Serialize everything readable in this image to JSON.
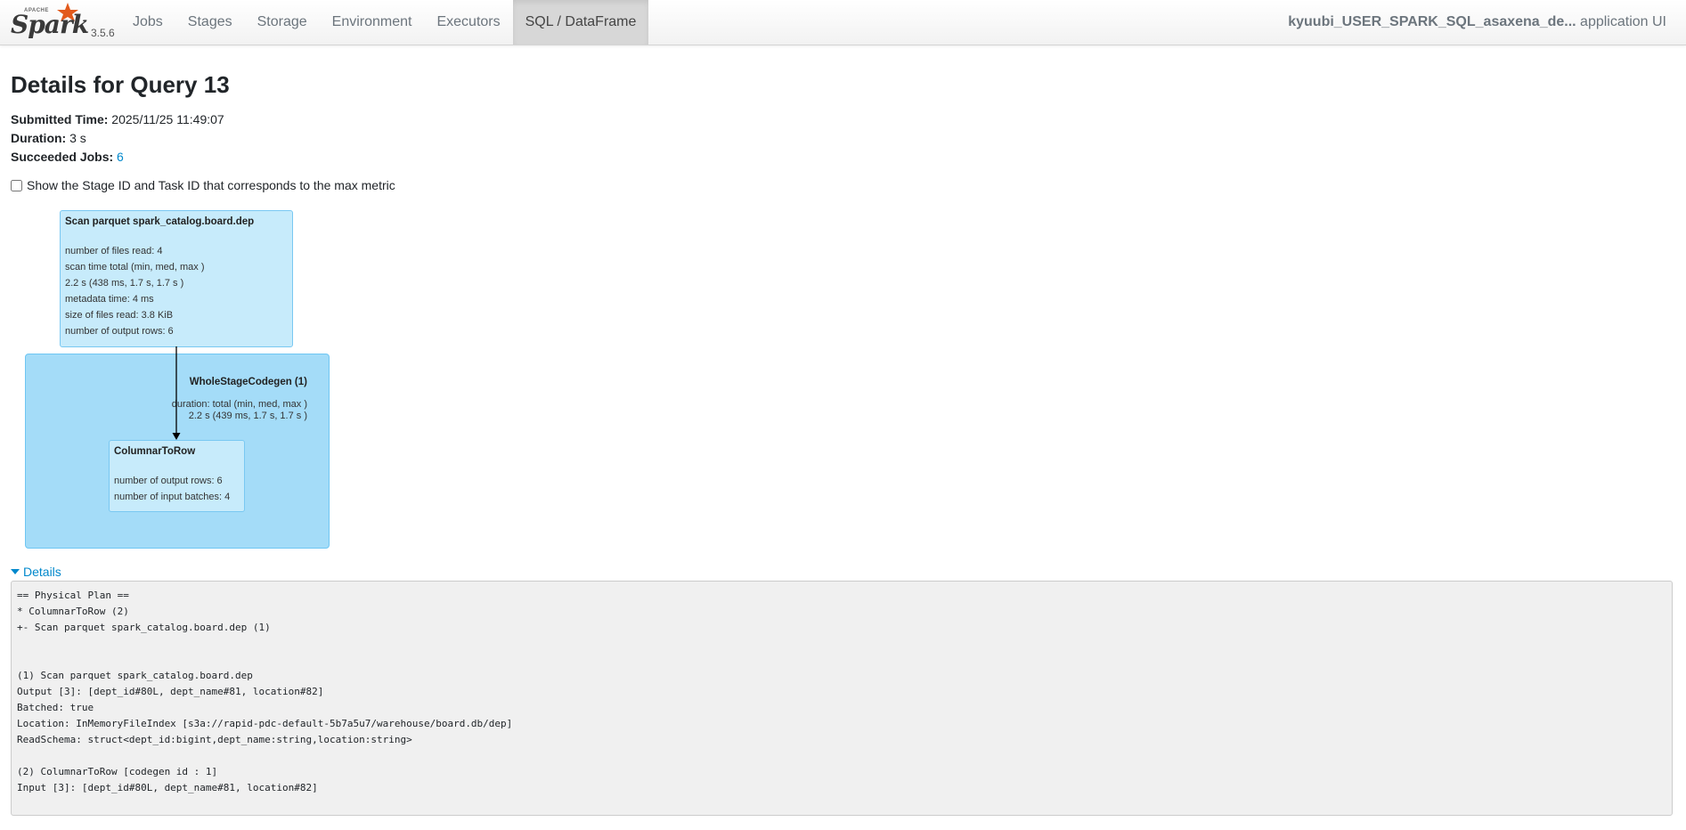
{
  "navbar": {
    "logo_word": "Spark",
    "logo_apache": "APACHE",
    "version": "3.5.6",
    "tabs": [
      {
        "label": "Jobs"
      },
      {
        "label": "Stages"
      },
      {
        "label": "Storage"
      },
      {
        "label": "Environment"
      },
      {
        "label": "Executors"
      },
      {
        "label": "SQL / DataFrame",
        "active": true
      }
    ],
    "app_name": "kyuubi_USER_SPARK_SQL_asaxena_de...",
    "app_suffix": " application UI"
  },
  "page": {
    "title": "Details for Query 13",
    "submitted_label": "Submitted Time:",
    "submitted_value": " 2025/11/25 11:49:07",
    "duration_label": "Duration:",
    "duration_value": " 3 s",
    "succeeded_label": "Succeeded Jobs:",
    "succeeded_value": "6",
    "max_metric_label": "Show the Stage ID and Task ID that corresponds to the max metric"
  },
  "graph": {
    "scan_node": {
      "title": "Scan parquet spark_catalog.board.dep",
      "metrics": [
        "number of files read: 4",
        "scan time total (min, med, max )",
        "2.2 s (438 ms, 1.7 s, 1.7 s )",
        "metadata time: 4 ms",
        "size of files read: 3.8 KiB",
        "number of output rows: 6"
      ]
    },
    "cluster": {
      "title": "WholeStageCodegen (1)",
      "line1": "duration: total (min, med, max )",
      "line2": "2.2 s (439 ms, 1.7 s, 1.7 s )"
    },
    "c2r_node": {
      "title": "ColumnarToRow",
      "metrics": [
        "number of output rows: 6",
        "number of input batches: 4"
      ]
    }
  },
  "details": {
    "toggle_label": "Details",
    "plan_text": "== Physical Plan ==\n* ColumnarToRow (2)\n+- Scan parquet spark_catalog.board.dep (1)\n\n\n(1) Scan parquet spark_catalog.board.dep\nOutput [3]: [dept_id#80L, dept_name#81, location#82]\nBatched: true\nLocation: InMemoryFileIndex [s3a://rapid-pdc-default-5b7a5u7/warehouse/board.db/dep]\nReadSchema: struct<dept_id:bigint,dept_name:string,location:string>\n\n(2) ColumnarToRow [codegen id : 1]\nInput [3]: [dept_id#80L, dept_name#81, location#82]"
  },
  "colors": {
    "link": "#0088cc",
    "cluster_fill": "#a4dcf8",
    "node_fill": "#c7ebfb",
    "logo_orange": "#e25a1c"
  }
}
